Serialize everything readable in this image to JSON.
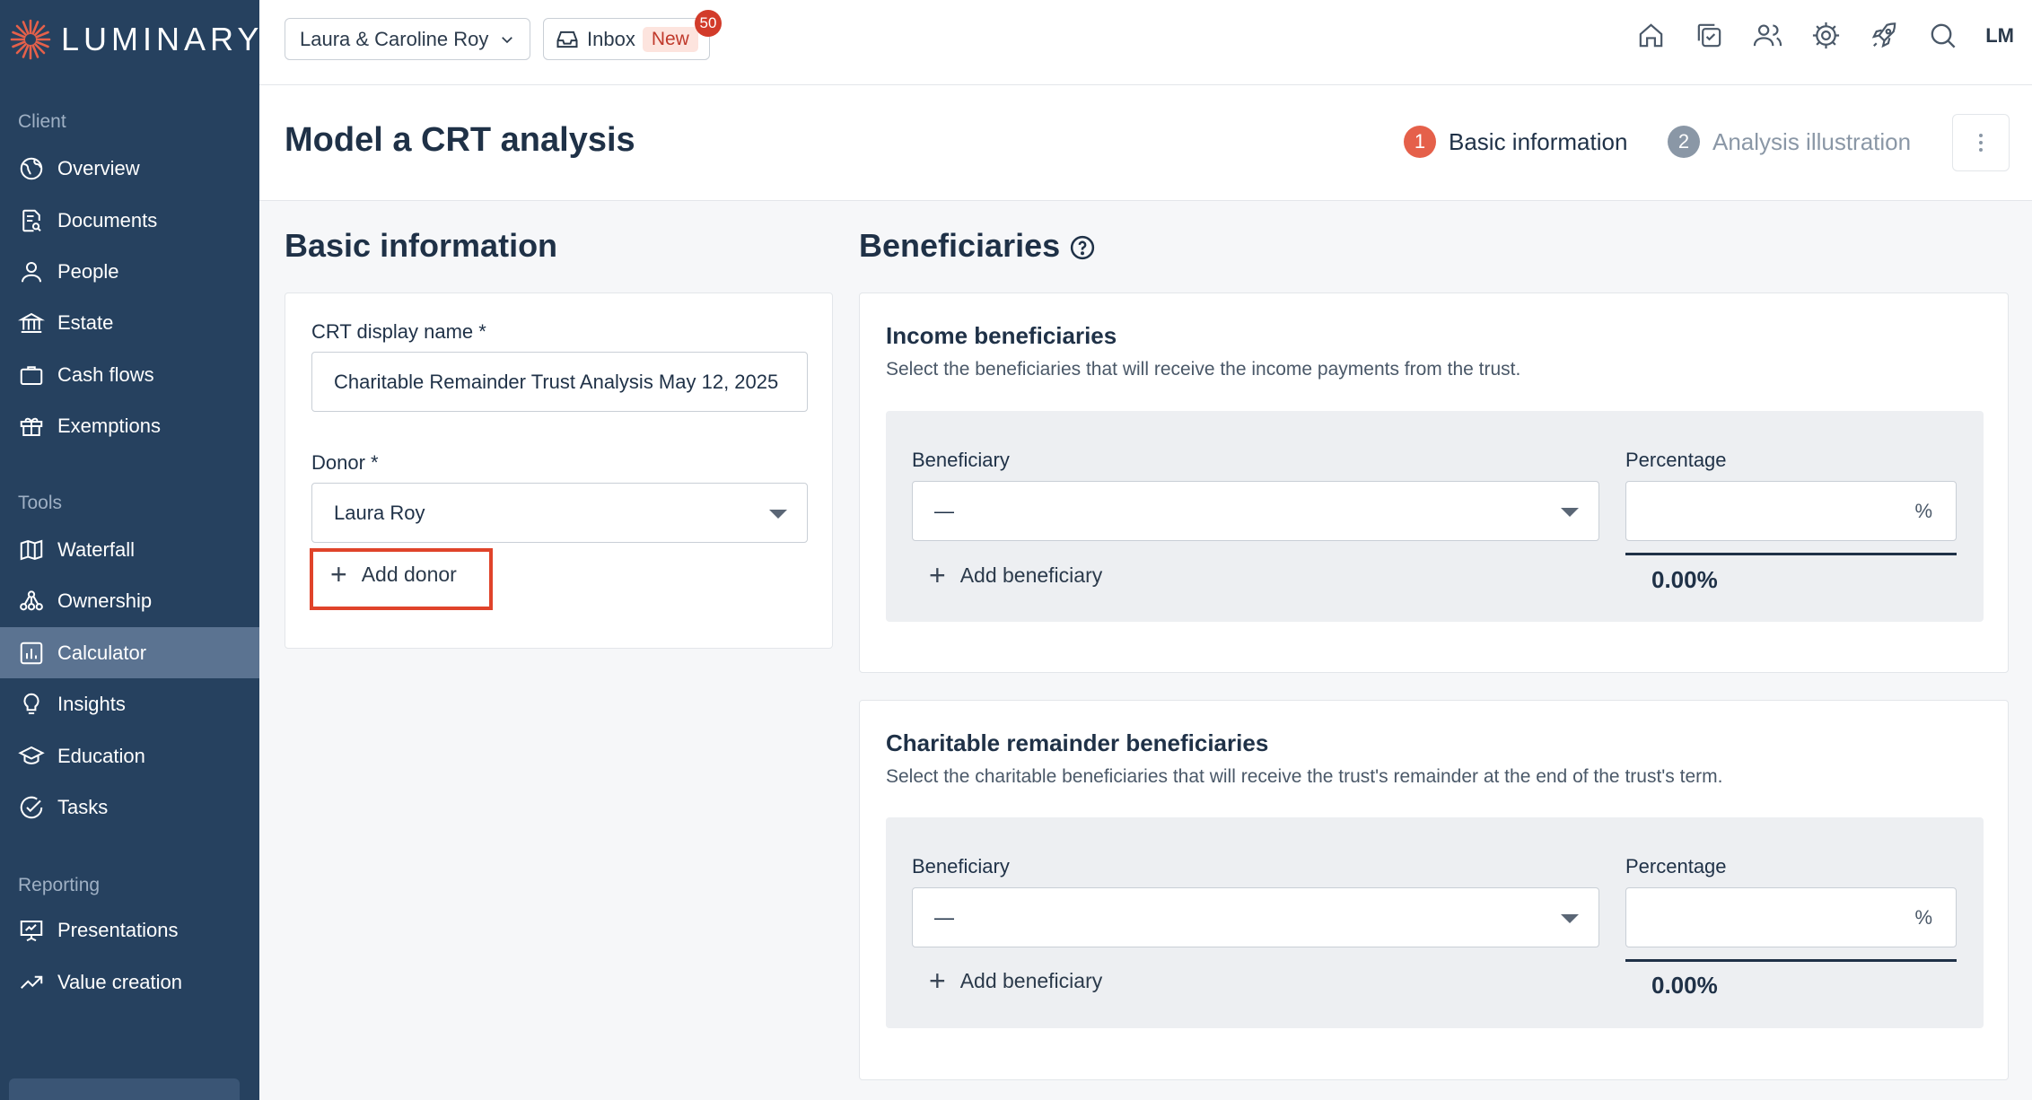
{
  "app": {
    "brand": "LUMINARY",
    "brand_color": "#e5604a",
    "sidebar_color": "#26415f"
  },
  "sidebar": {
    "sections": [
      {
        "label": "Client",
        "items": [
          {
            "label": "Overview",
            "icon": "globe-icon"
          },
          {
            "label": "Documents",
            "icon": "document-search-icon"
          },
          {
            "label": "People",
            "icon": "person-icon"
          },
          {
            "label": "Estate",
            "icon": "bank-icon"
          },
          {
            "label": "Cash flows",
            "icon": "briefcase-icon"
          },
          {
            "label": "Exemptions",
            "icon": "gift-icon"
          }
        ]
      },
      {
        "label": "Tools",
        "items": [
          {
            "label": "Waterfall",
            "icon": "map-icon"
          },
          {
            "label": "Ownership",
            "icon": "hierarchy-icon"
          },
          {
            "label": "Calculator",
            "icon": "calculator-chart-icon",
            "active": true
          },
          {
            "label": "Insights",
            "icon": "lightbulb-icon"
          },
          {
            "label": "Education",
            "icon": "graduation-cap-icon"
          },
          {
            "label": "Tasks",
            "icon": "check-circle-icon"
          }
        ]
      },
      {
        "label": "Reporting",
        "items": [
          {
            "label": "Presentations",
            "icon": "presentation-icon"
          },
          {
            "label": "Value creation",
            "icon": "trend-up-icon"
          }
        ]
      }
    ]
  },
  "topbar": {
    "client_name": "Laura & Caroline Roy",
    "inbox_label": "Inbox",
    "inbox_badge": "New",
    "inbox_count": "50",
    "avatar_initials": "LM",
    "icons": [
      "home-icon",
      "tasks-icon",
      "users-icon",
      "settings-icon",
      "rocket-icon",
      "search-icon"
    ]
  },
  "header": {
    "title": "Model a CRT analysis",
    "steps": [
      {
        "num": "1",
        "label": "Basic information",
        "active": true
      },
      {
        "num": "2",
        "label": "Analysis illustration",
        "active": false
      }
    ]
  },
  "basic_info": {
    "title": "Basic information",
    "crt_name_label": "CRT display name *",
    "crt_name_value": "Charitable Remainder Trust Analysis May 12, 2025",
    "donor_label": "Donor *",
    "donor_value": "Laura Roy",
    "add_donor_label": "Add donor"
  },
  "beneficiaries": {
    "title": "Beneficiaries",
    "income": {
      "heading": "Income beneficiaries",
      "description": "Select the beneficiaries that will receive the income payments from the trust.",
      "beneficiary_label": "Beneficiary",
      "beneficiary_value": "—",
      "percentage_label": "Percentage",
      "percentage_suffix": "%",
      "add_label": "Add beneficiary",
      "total": "0.00%"
    },
    "charitable": {
      "heading": "Charitable remainder beneficiaries",
      "description": "Select the charitable beneficiaries that will receive the trust's remainder at the end of the trust's term.",
      "beneficiary_label": "Beneficiary",
      "beneficiary_value": "—",
      "percentage_label": "Percentage",
      "percentage_suffix": "%",
      "add_label": "Add beneficiary",
      "total": "0.00%"
    }
  }
}
